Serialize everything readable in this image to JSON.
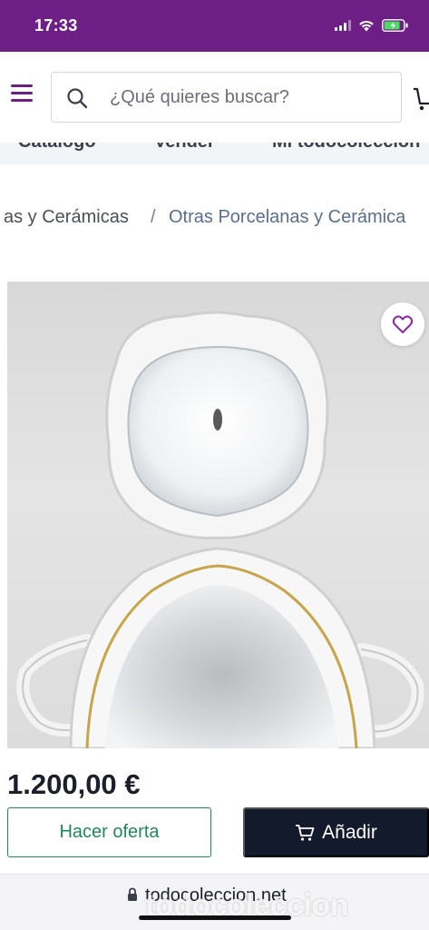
{
  "status_bar": {
    "time": "17:33"
  },
  "header": {
    "search": {
      "placeholder": "¿Qué quieres buscar?"
    }
  },
  "nav": {
    "tabs": [
      "Catálogo",
      "Vender",
      "Mi todocoleccion"
    ]
  },
  "breadcrumb": {
    "items": [
      "as y Cerámicas",
      "/",
      "Otras Porcelanas y Cerámica"
    ]
  },
  "product": {
    "price": "1.200,00 €"
  },
  "actions": {
    "offer_label": "Hacer oferta",
    "add_label": "Añadir"
  },
  "browser": {
    "url": "todocoleccion.net",
    "watermark": "todocoleccion"
  },
  "icons": [
    "menu-icon",
    "search-icon",
    "cart-icon",
    "heart-icon",
    "lock-icon",
    "wifi-icon",
    "battery-icon"
  ],
  "colors": {
    "brand": "#6d1f86",
    "offer": "#1e8a5a",
    "add_button": "#131a2c"
  }
}
